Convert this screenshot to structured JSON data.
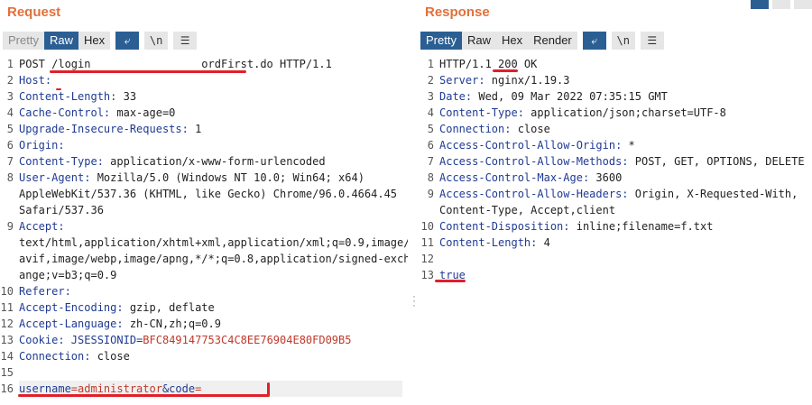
{
  "request": {
    "title": "Request",
    "tabs": [
      "Pretty",
      "Raw",
      "Hex"
    ],
    "active_tab": "Raw",
    "icons": [
      "wrap-icon",
      "newline-icon",
      "menu-icon"
    ],
    "icon_text": {
      "newline": "\\n",
      "menu": "☰",
      "wrap": "⤶"
    },
    "lines": [
      {
        "n": "1",
        "segments": [
          {
            "t": "POST "
          },
          {
            "t": "/login                 ordFirst.do"
          },
          {
            "t": " HTTP/1.1"
          }
        ]
      },
      {
        "n": "2",
        "segments": [
          {
            "t": "Host:",
            "k": true
          }
        ]
      },
      {
        "n": "3",
        "segments": [
          {
            "t": "Content-Length:",
            "k": true
          },
          {
            "t": " 33"
          }
        ]
      },
      {
        "n": "4",
        "segments": [
          {
            "t": "Cache-Control:",
            "k": true
          },
          {
            "t": " max-age=0"
          }
        ]
      },
      {
        "n": "5",
        "segments": [
          {
            "t": "Upgrade-Insecure-Requests:",
            "k": true
          },
          {
            "t": " 1"
          }
        ]
      },
      {
        "n": "6",
        "segments": [
          {
            "t": "Origin:",
            "k": true
          }
        ]
      },
      {
        "n": "7",
        "segments": [
          {
            "t": "Content-Type:",
            "k": true
          },
          {
            "t": " application/x-www-form-urlencoded"
          }
        ]
      },
      {
        "n": "8",
        "segments": [
          {
            "t": "User-Agent:",
            "k": true
          },
          {
            "t": " Mozilla/5.0 (Windows NT 10.0; Win64; x64)"
          }
        ]
      },
      {
        "n": "",
        "segments": [
          {
            "t": "AppleWebKit/537.36 (KHTML, like Gecko) Chrome/96.0.4664.45"
          }
        ]
      },
      {
        "n": "",
        "segments": [
          {
            "t": "Safari/537.36"
          }
        ]
      },
      {
        "n": "9",
        "segments": [
          {
            "t": "Accept:",
            "k": true
          }
        ]
      },
      {
        "n": "",
        "segments": [
          {
            "t": "text/html,application/xhtml+xml,application/xml;q=0.9,image/"
          }
        ]
      },
      {
        "n": "",
        "segments": [
          {
            "t": "avif,image/webp,image/apng,*/*;q=0.8,application/signed-exch"
          }
        ]
      },
      {
        "n": "",
        "segments": [
          {
            "t": "ange;v=b3;q=0.9"
          }
        ]
      },
      {
        "n": "10",
        "segments": [
          {
            "t": "Referer:",
            "k": true
          }
        ]
      },
      {
        "n": "11",
        "segments": [
          {
            "t": "Accept-Encoding:",
            "k": true
          },
          {
            "t": " gzip, deflate"
          }
        ]
      },
      {
        "n": "12",
        "segments": [
          {
            "t": "Accept-Language:",
            "k": true
          },
          {
            "t": " zh-CN,zh;q=0.9"
          }
        ]
      },
      {
        "n": "13",
        "segments": [
          {
            "t": "Cookie:",
            "k": true
          },
          {
            "t": " JSESSIONID",
            "k": true
          },
          {
            "t": "=",
            "k": true
          },
          {
            "t": "BFC849147753C4C8EE76904E80FD09B5",
            "red": true
          }
        ]
      },
      {
        "n": "14",
        "segments": [
          {
            "t": "Connection:",
            "k": true
          },
          {
            "t": " close"
          }
        ]
      },
      {
        "n": "15",
        "segments": []
      },
      {
        "n": "16",
        "segments": [
          {
            "t": "username",
            "k": true
          },
          {
            "t": "=",
            "red": true
          },
          {
            "t": "administrator",
            "red": true
          },
          {
            "t": "&code",
            "k": true
          },
          {
            "t": "=",
            "red": true
          }
        ],
        "highlight": true
      }
    ]
  },
  "response": {
    "title": "Response",
    "tabs": [
      "Pretty",
      "Raw",
      "Hex",
      "Render"
    ],
    "active_tab": "Pretty",
    "icons": [
      "wrap-icon",
      "newline-icon",
      "menu-icon"
    ],
    "icon_text": {
      "newline": "\\n",
      "menu": "☰",
      "wrap": "⤶"
    },
    "lines": [
      {
        "n": "1",
        "segments": [
          {
            "t": "HTTP/1.1 200 OK"
          }
        ]
      },
      {
        "n": "2",
        "segments": [
          {
            "t": "Server:",
            "k": true
          },
          {
            "t": " nginx/1.19.3"
          }
        ]
      },
      {
        "n": "3",
        "segments": [
          {
            "t": "Date:",
            "k": true
          },
          {
            "t": " Wed, 09 Mar 2022 07:35:15 GMT"
          }
        ]
      },
      {
        "n": "4",
        "segments": [
          {
            "t": "Content-Type:",
            "k": true
          },
          {
            "t": " application/json;charset=UTF-8"
          }
        ]
      },
      {
        "n": "5",
        "segments": [
          {
            "t": "Connection:",
            "k": true
          },
          {
            "t": " close"
          }
        ]
      },
      {
        "n": "6",
        "segments": [
          {
            "t": "Access-Control-Allow-Origin:",
            "k": true
          },
          {
            "t": " *"
          }
        ]
      },
      {
        "n": "7",
        "segments": [
          {
            "t": "Access-Control-Allow-Methods:",
            "k": true
          },
          {
            "t": " POST, GET, OPTIONS, DELETE"
          }
        ]
      },
      {
        "n": "8",
        "segments": [
          {
            "t": "Access-Control-Max-Age:",
            "k": true
          },
          {
            "t": " 3600"
          }
        ]
      },
      {
        "n": "9",
        "segments": [
          {
            "t": "Access-Control-Allow-Headers:",
            "k": true
          },
          {
            "t": " Origin, X-Requested-With,"
          }
        ]
      },
      {
        "n": "",
        "segments": [
          {
            "t": "Content-Type, Accept,client"
          }
        ]
      },
      {
        "n": "10",
        "segments": [
          {
            "t": "Content-Disposition:",
            "k": true
          },
          {
            "t": " inline;filename=f.txt"
          }
        ]
      },
      {
        "n": "11",
        "segments": [
          {
            "t": "Content-Length:",
            "k": true
          },
          {
            "t": " 4"
          }
        ]
      },
      {
        "n": "12",
        "segments": []
      },
      {
        "n": "13",
        "segments": [
          {
            "t": "true",
            "k": true
          }
        ]
      }
    ]
  },
  "colors": {
    "title": "#e36f3a",
    "active_tab": "#2b5f93",
    "header_key": "#1f3a93",
    "cookie_value": "#c0392b",
    "annotation": "#e0202a"
  }
}
